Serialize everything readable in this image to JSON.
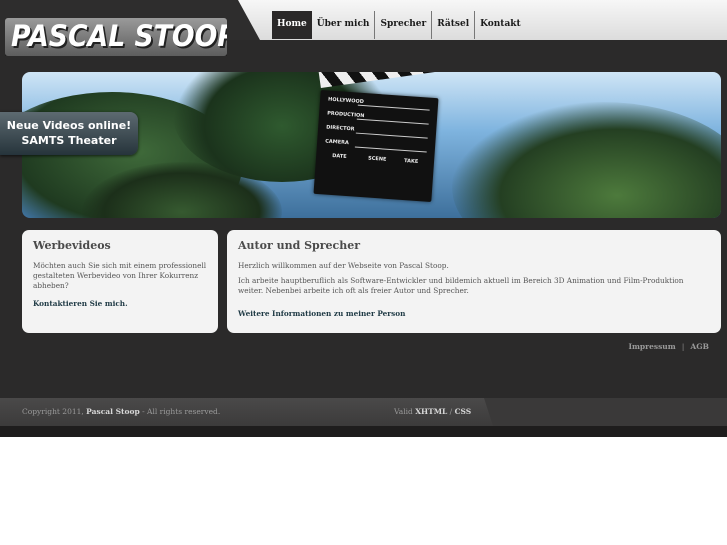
{
  "site": {
    "logo": "PASCAL STOOP"
  },
  "nav": {
    "items": [
      {
        "label": "Home",
        "active": true
      },
      {
        "label": "Über mich"
      },
      {
        "label": "Sprecher"
      },
      {
        "label": "Rätsel"
      },
      {
        "label": "Kontakt"
      }
    ]
  },
  "banner": {
    "clapper_labels": [
      "HOLLYWOOD",
      "PRODUCTION",
      "DIRECTOR",
      "CAMERA",
      "DATE",
      "SCENE",
      "TAKE"
    ]
  },
  "promo": {
    "line1": "Neue Videos online!",
    "line2": "SAMTS Theater"
  },
  "left_box": {
    "title": "Werbevideos",
    "text": "Möchten auch Sie sich mit einem professionell gestalteten Werbevideo von Ihrer Kokurrenz abheben?",
    "link": "Kontaktieren Sie mich."
  },
  "right_box": {
    "title": "Autor und Sprecher",
    "p1": "Herzlich willkommen auf der Webseite von Pascal Stoop.",
    "p2": "Ich arbeite hauptberuflich als Software-Entwickler und bildemich aktuell im Bereich 3D Animation und Film-Produktion weiter. Nebenbei arbeite ich oft als freier Autor und Sprecher.",
    "link": "Weitere Informationen zu meiner Person"
  },
  "footer": {
    "links": [
      "Impressum",
      "AGB"
    ],
    "copy_prefix": "Copyright 2011,",
    "copy_name": "Pascal Stoop",
    "copy_suffix": " -  All rights reserved.",
    "valid_prefix": "Valid",
    "valid_xhtml": "XHTML",
    "valid_sep": "/",
    "valid_css": "CSS"
  }
}
